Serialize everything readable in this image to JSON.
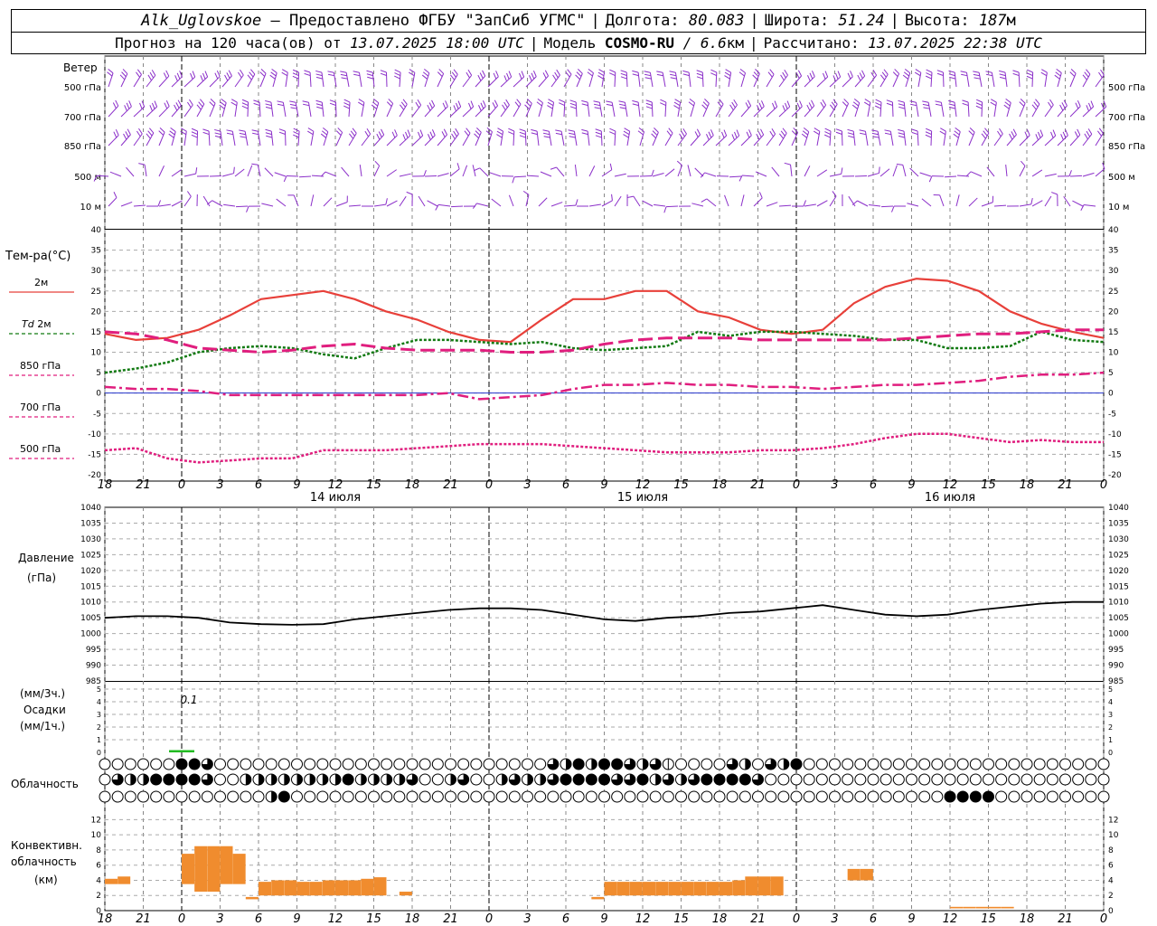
{
  "header": {
    "station": "Alk_Uglovskoe",
    "provider": "– Предоставлено ФГБУ \"ЗапСиб УГМС\"",
    "lon_label": "Долгота:",
    "lon": "80.083",
    "lat_label": "Широта:",
    "lat": "51.24",
    "alt_label": "Высота:",
    "alt": "187",
    "alt_unit": "м",
    "forecast_prefix": "Прогноз на 120 часа(ов) от",
    "forecast_start": "13.07.2025 18:00 UTC",
    "model_label": "Модель",
    "model": "COSMO-RU",
    "resolution": "/ 6.6",
    "resolution_unit": "км",
    "computed_label": "Рассчитано:",
    "computed": "13.07.2025 22:38 UTC"
  },
  "labels": {
    "wind": "Ветер",
    "temp": "Тем-ра(°C)",
    "t2m": "2м",
    "td": "Td",
    "td2m": "2м",
    "l850": "850 гПа",
    "l700": "700 гПа",
    "l500": "500 гПа",
    "pressure": "Давление",
    "pressure_unit": "(гПа)",
    "precip_unit3": "(мм/3ч.)",
    "precip": "Осадки",
    "precip_unit1": "(мм/1ч.)",
    "cloud": "Облачность",
    "conv1": "Конвективн.",
    "conv2": "облачность",
    "conv3": "(км)"
  },
  "colors": {
    "wind": "#8b2fc9",
    "t2m": "#e8403a",
    "td": "#127a12",
    "t850": "#e01e7e",
    "t700": "#e01e7e",
    "t500": "#e01e7e",
    "pressure": "#000000",
    "precip": "#22bb22",
    "conv": "#f08c2e"
  },
  "chart_data": [
    {
      "type": "wind-barbs",
      "levels": [
        "500 гПа",
        "700 гПа",
        "850 гПа",
        "500 м",
        "10 м"
      ]
    },
    {
      "type": "line",
      "ylim": [
        -20,
        40
      ],
      "yticks": [
        -20,
        -15,
        -10,
        -5,
        0,
        5,
        10,
        15,
        20,
        25,
        30,
        35,
        40
      ],
      "x_tick_labels": [
        "18",
        "21",
        "0",
        "3",
        "6",
        "9",
        "12",
        "15",
        "18",
        "21",
        "0",
        "3",
        "6",
        "9",
        "12",
        "15",
        "18",
        "21",
        "0",
        "3",
        "6",
        "9",
        "12",
        "15",
        "18",
        "21",
        "0"
      ],
      "day_labels": [
        "14 июля",
        "15 июля",
        "16 июля"
      ],
      "x_hours": [
        0,
        3,
        6,
        9,
        12,
        15,
        18,
        21,
        24,
        27,
        30,
        33,
        36,
        39,
        42,
        45,
        48,
        51,
        54,
        57,
        60,
        63,
        66,
        69,
        72,
        75,
        78
      ],
      "series": [
        {
          "name": "2м",
          "values": [
            14.5,
            13,
            13.5,
            15.5,
            19,
            23,
            24,
            25,
            23,
            20,
            18,
            15,
            13,
            12.5,
            18,
            23,
            23,
            25,
            25,
            20,
            18.5,
            15.5,
            14.5,
            15.5,
            22,
            26,
            28,
            27.5,
            25,
            20,
            17,
            15,
            13.5
          ]
        },
        {
          "name": "Td 2м",
          "values": [
            5,
            6,
            7.5,
            10,
            11,
            11.5,
            11,
            9.5,
            8.5,
            11,
            13,
            13,
            12.5,
            12,
            12.5,
            11,
            10.5,
            11,
            11.5,
            15,
            14,
            15,
            15,
            14.5,
            14,
            13,
            13,
            11,
            11,
            11.5,
            15,
            13,
            12.5
          ]
        },
        {
          "name": "850 гПа",
          "values": [
            15,
            14.5,
            13,
            11,
            10.5,
            10,
            10.5,
            11.5,
            12,
            11,
            10.5,
            10.5,
            10.5,
            10,
            10,
            10.5,
            12,
            13,
            13.5,
            13.5,
            13.5,
            13,
            13,
            13,
            13,
            13,
            13.5,
            14,
            14.5,
            14.5,
            15,
            15.5,
            15.5
          ]
        },
        {
          "name": "700 гПа",
          "values": [
            1.5,
            1,
            1,
            0.5,
            -0.5,
            -0.5,
            -0.5,
            -0.5,
            -0.5,
            -0.5,
            -0.5,
            0,
            -1.5,
            -1,
            -0.5,
            1,
            2,
            2,
            2.5,
            2,
            2,
            1.5,
            1.5,
            1,
            1.5,
            2,
            2,
            2.5,
            3,
            4,
            4.5,
            4.5,
            5
          ]
        },
        {
          "name": "500 гПа",
          "values": [
            -14,
            -13.5,
            -16,
            -17,
            -16.5,
            -16,
            -16,
            -14,
            -14,
            -14,
            -13.5,
            -13,
            -12.5,
            -12.5,
            -12.5,
            -13,
            -13.5,
            -14,
            -14.5,
            -14.5,
            -14.5,
            -14,
            -14,
            -13.5,
            -12.5,
            -11,
            -10,
            -10,
            -11,
            -12,
            -11.5,
            -12,
            -12
          ]
        }
      ]
    },
    {
      "type": "line",
      "ylim": [
        985,
        1040
      ],
      "yticks": [
        985,
        990,
        995,
        1000,
        1005,
        1010,
        1015,
        1020,
        1025,
        1030,
        1035,
        1040
      ],
      "series": [
        {
          "name": "Давление",
          "values": [
            1005,
            1005.5,
            1005.5,
            1005,
            1003.5,
            1003,
            1002.8,
            1003,
            1004.5,
            1005.5,
            1006.5,
            1007.5,
            1008,
            1008,
            1007.5,
            1006,
            1004.5,
            1004,
            1005,
            1005.5,
            1006.5,
            1007,
            1008,
            1009,
            1007.5,
            1006,
            1005.5,
            1006,
            1007.5,
            1008.5,
            1009.5,
            1010,
            1010
          ]
        }
      ]
    },
    {
      "type": "bar",
      "ylim": [
        0,
        5
      ],
      "yticks": [
        0,
        1,
        2,
        3,
        4,
        5
      ],
      "annotation": "0.1",
      "bars": [
        {
          "x_hours": 6,
          "value": 0.1
        }
      ]
    },
    {
      "type": "table",
      "name": "Облачность",
      "rows": [
        "OOOOOOFFQOOOOOOOOOOOOOOOOOOOOOOOOOOQHFHFFQHQPOOOOQHOQHFOOOOOOOOOOOOOOOOOOOOOOOOOOOOOOOOOOOO",
        "OQHHFFFFQOOHHHHHHHHFHHHHQOOHQOOHQHHQFFFFQQFHQHQFFFFQOOOOOOOOOOOOOOOOOOOOOOOOOOOOOOOOOOOOOOOO",
        "OOOOOOOOOOOOOHFOOOOOOOOOOOOOOOOOOOOOOOOOOOOOOOOOOOOOOOOOOOOOOOOOOOFFFFOOOOOOOOOOOOOOOOOOOOOO"
      ]
    },
    {
      "type": "bar",
      "ylim": [
        0,
        13
      ],
      "yticks": [
        0,
        2,
        4,
        6,
        8,
        10,
        12
      ],
      "bars": [
        {
          "x_hours": 0,
          "bottom": 3.5,
          "top": 4.2
        },
        {
          "x_hours": 1,
          "bottom": 3.5,
          "top": 4.5
        },
        {
          "x_hours": 6,
          "bottom": 3.5,
          "top": 7.5
        },
        {
          "x_hours": 7,
          "bottom": 2.5,
          "top": 8.5
        },
        {
          "x_hours": 8,
          "bottom": 2.5,
          "top": 8.5
        },
        {
          "x_hours": 9,
          "bottom": 3.5,
          "top": 8.5
        },
        {
          "x_hours": 10,
          "bottom": 3.5,
          "top": 7.5
        },
        {
          "x_hours": 11,
          "bottom": 1.5,
          "top": 1.8
        },
        {
          "x_hours": 12,
          "bottom": 2.0,
          "top": 3.8
        },
        {
          "x_hours": 13,
          "bottom": 2.0,
          "top": 4.0
        },
        {
          "x_hours": 14,
          "bottom": 2.0,
          "top": 4.0
        },
        {
          "x_hours": 15,
          "bottom": 2.0,
          "top": 3.8
        },
        {
          "x_hours": 16,
          "bottom": 2.0,
          "top": 3.8
        },
        {
          "x_hours": 17,
          "bottom": 2.0,
          "top": 4.0
        },
        {
          "x_hours": 18,
          "bottom": 2.0,
          "top": 4.0
        },
        {
          "x_hours": 19,
          "bottom": 2.0,
          "top": 4.0
        },
        {
          "x_hours": 20,
          "bottom": 2.0,
          "top": 4.2
        },
        {
          "x_hours": 21,
          "bottom": 2.0,
          "top": 4.4
        },
        {
          "x_hours": 23,
          "bottom": 2.0,
          "top": 2.5
        },
        {
          "x_hours": 38,
          "bottom": 1.5,
          "top": 1.8
        },
        {
          "x_hours": 39,
          "bottom": 2.0,
          "top": 3.8
        },
        {
          "x_hours": 40,
          "bottom": 2.0,
          "top": 3.8
        },
        {
          "x_hours": 41,
          "bottom": 2.0,
          "top": 3.8
        },
        {
          "x_hours": 42,
          "bottom": 2.0,
          "top": 3.8
        },
        {
          "x_hours": 43,
          "bottom": 2.0,
          "top": 3.8
        },
        {
          "x_hours": 44,
          "bottom": 2.0,
          "top": 3.8
        },
        {
          "x_hours": 45,
          "bottom": 2.0,
          "top": 3.8
        },
        {
          "x_hours": 46,
          "bottom": 2.0,
          "top": 3.8
        },
        {
          "x_hours": 47,
          "bottom": 2.0,
          "top": 3.8
        },
        {
          "x_hours": 48,
          "bottom": 2.0,
          "top": 3.8
        },
        {
          "x_hours": 49,
          "bottom": 2.0,
          "top": 4.0
        },
        {
          "x_hours": 50,
          "bottom": 2.0,
          "top": 4.5
        },
        {
          "x_hours": 51,
          "bottom": 2.0,
          "top": 4.5
        },
        {
          "x_hours": 52,
          "bottom": 2.0,
          "top": 4.5
        },
        {
          "x_hours": 58,
          "bottom": 4.0,
          "top": 5.5
        },
        {
          "x_hours": 59,
          "bottom": 4.0,
          "top": 5.5
        },
        {
          "x_hours": 66,
          "bottom": 0.3,
          "top": 0.5
        },
        {
          "x_hours": 67,
          "bottom": 0.3,
          "top": 0.5
        },
        {
          "x_hours": 68,
          "bottom": 0.3,
          "top": 0.5
        },
        {
          "x_hours": 69,
          "bottom": 0.3,
          "top": 0.5
        },
        {
          "x_hours": 70,
          "bottom": 0.3,
          "top": 0.5
        }
      ]
    }
  ]
}
